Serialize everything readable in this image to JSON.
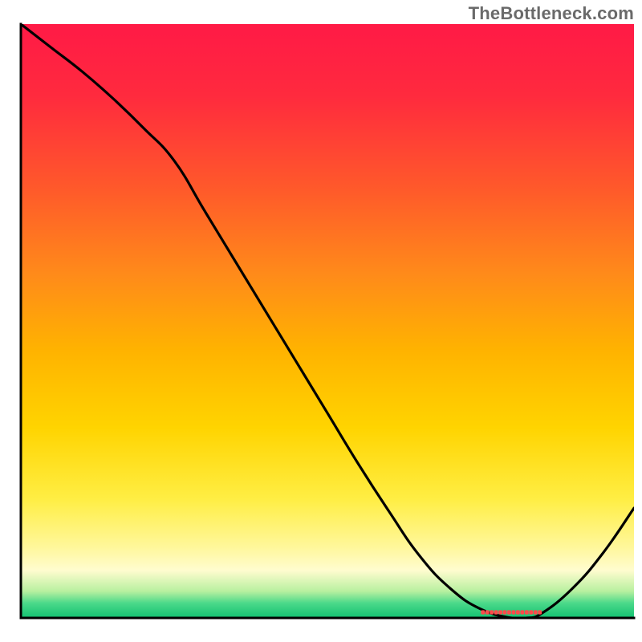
{
  "attribution": "TheBottleneck.com",
  "plot": {
    "x_range": [
      0,
      100
    ],
    "y_range": [
      0,
      100
    ],
    "axes_color": "#000000",
    "axes_width": 3
  },
  "gradient_stops": [
    {
      "offset": 0,
      "color": "#ff1a46"
    },
    {
      "offset": 0.12,
      "color": "#ff2a3e"
    },
    {
      "offset": 0.28,
      "color": "#ff5a2a"
    },
    {
      "offset": 0.42,
      "color": "#ff8a1a"
    },
    {
      "offset": 0.55,
      "color": "#ffb300"
    },
    {
      "offset": 0.68,
      "color": "#ffd400"
    },
    {
      "offset": 0.8,
      "color": "#ffee44"
    },
    {
      "offset": 0.88,
      "color": "#fff79a"
    },
    {
      "offset": 0.92,
      "color": "#fffccf"
    },
    {
      "offset": 0.955,
      "color": "#b8f0a0"
    },
    {
      "offset": 0.975,
      "color": "#4bd98a"
    },
    {
      "offset": 1.0,
      "color": "#12c171"
    }
  ],
  "chart_data": {
    "type": "line",
    "title": "",
    "xlabel": "",
    "ylabel": "",
    "x": [
      0,
      5,
      10,
      15,
      20,
      25,
      30,
      35,
      40,
      45,
      50,
      55,
      60,
      65,
      70,
      75,
      80,
      82.5,
      85,
      90,
      95,
      100
    ],
    "values": [
      100,
      96,
      92,
      87.5,
      82.5,
      77,
      68.5,
      60,
      51.5,
      43,
      34.5,
      26,
      18,
      10.5,
      5,
      1.5,
      0,
      0,
      0.8,
      5,
      11,
      18.5
    ],
    "xlim": [
      0,
      100
    ],
    "ylim": [
      0,
      100
    ],
    "optimal_band": {
      "start": 75,
      "end": 85,
      "color": "#ff4a4a"
    },
    "note": "V-shaped bottleneck curve descending from top-left, flattening near bottom around x≈75–85, then rising toward the right edge."
  }
}
